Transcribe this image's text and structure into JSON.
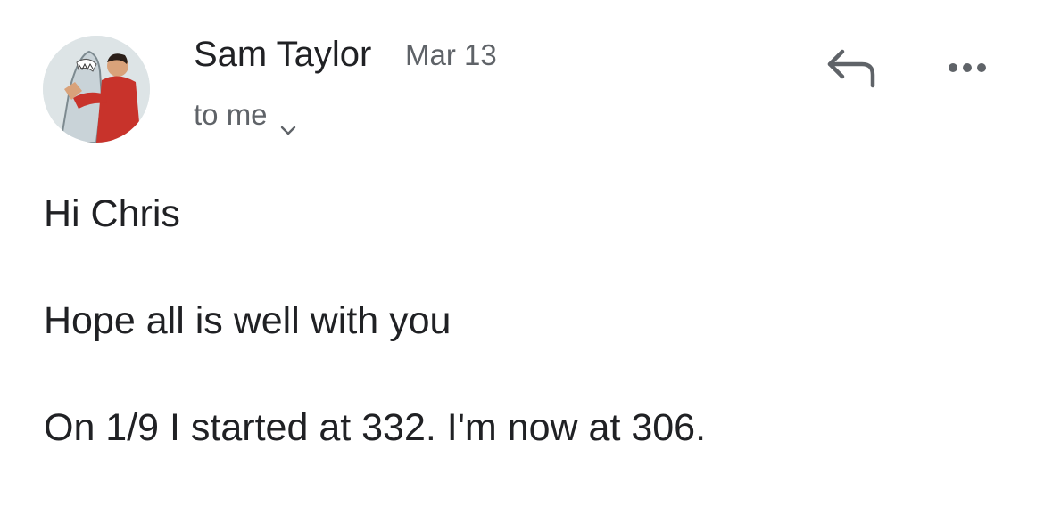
{
  "sender": {
    "name": "Sam Taylor",
    "date": "Mar 13",
    "avatar_icon": "avatar-photo-icon"
  },
  "recipient": {
    "label": "to me",
    "expand_icon": "chevron-down-icon"
  },
  "actions": {
    "reply_icon": "reply-arrow-icon",
    "more_icon": "more-horizontal-icon"
  },
  "message": {
    "lines": [
      "Hi Chris",
      "Hope all is well with you",
      "On 1/9 I started at 332. I'm now at 306."
    ]
  },
  "colors": {
    "text_primary": "#202124",
    "text_secondary": "#5f6368",
    "icon": "#5f6368",
    "background": "#ffffff"
  }
}
